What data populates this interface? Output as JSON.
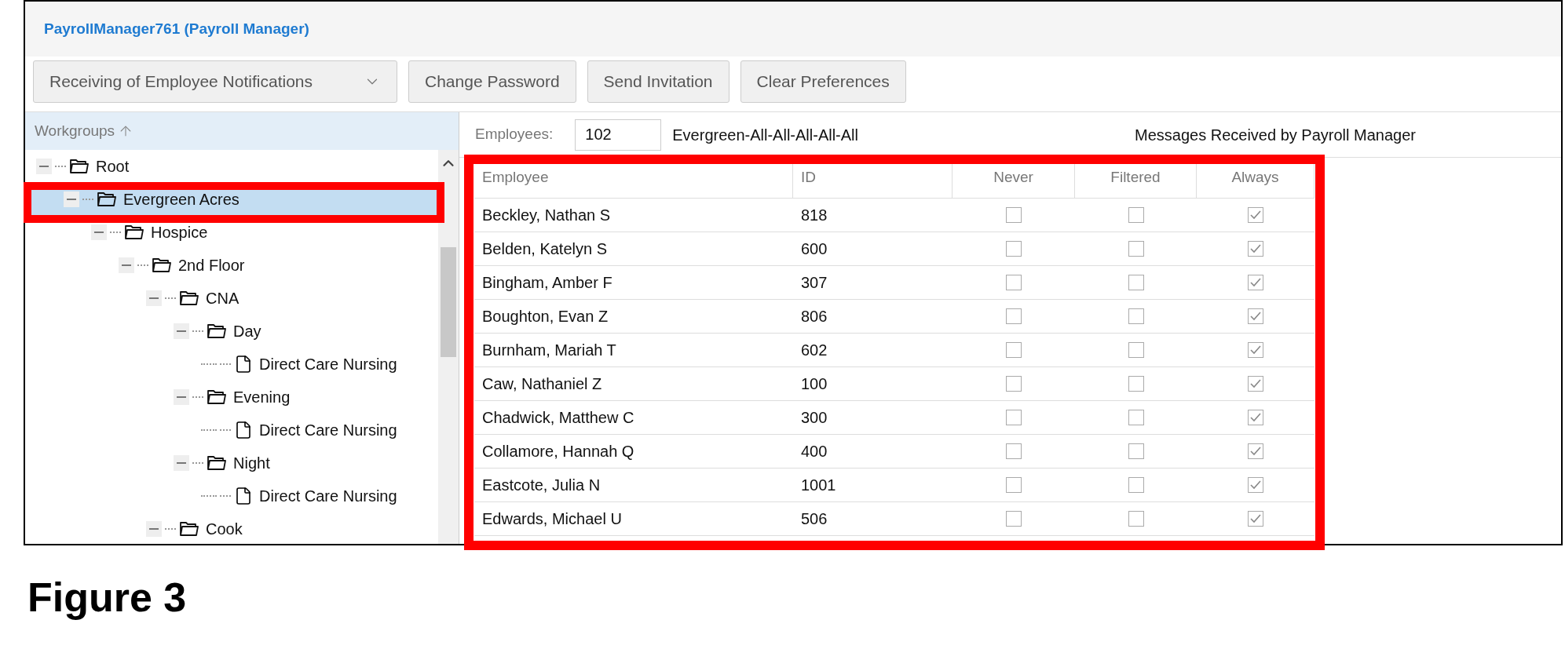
{
  "header": {
    "title": "PayrollManager761 (Payroll Manager)"
  },
  "toolbar": {
    "dropdown": "Receiving of Employee Notifications",
    "buttons": [
      "Change Password",
      "Send Invitation",
      "Clear Preferences"
    ]
  },
  "tree_header": "Workgroups",
  "tree": [
    {
      "label": "Root",
      "kind": "folder",
      "expanded": true,
      "selected": false,
      "children": [
        {
          "label": "Evergreen Acres",
          "kind": "folder",
          "expanded": true,
          "selected": true,
          "children": [
            {
              "label": "Hospice",
              "kind": "folder",
              "expanded": true,
              "selected": false,
              "children": [
                {
                  "label": "2nd Floor",
                  "kind": "folder",
                  "expanded": true,
                  "selected": false,
                  "children": [
                    {
                      "label": "CNA",
                      "kind": "folder",
                      "expanded": true,
                      "selected": false,
                      "children": [
                        {
                          "label": "Day",
                          "kind": "folder",
                          "expanded": true,
                          "selected": false,
                          "children": [
                            {
                              "label": "Direct Care Nursing",
                              "kind": "file",
                              "selected": false
                            }
                          ]
                        },
                        {
                          "label": "Evening",
                          "kind": "folder",
                          "expanded": true,
                          "selected": false,
                          "children": [
                            {
                              "label": "Direct Care Nursing",
                              "kind": "file",
                              "selected": false
                            }
                          ]
                        },
                        {
                          "label": "Night",
                          "kind": "folder",
                          "expanded": true,
                          "selected": false,
                          "children": [
                            {
                              "label": "Direct Care Nursing",
                              "kind": "file",
                              "selected": false
                            }
                          ]
                        }
                      ]
                    },
                    {
                      "label": "Cook",
                      "kind": "folder",
                      "expanded": true,
                      "selected": false
                    }
                  ]
                }
              ]
            }
          ]
        }
      ]
    }
  ],
  "employees_bar": {
    "label": "Employees:",
    "count": "102",
    "filter": "Evergreen-All-All-All-All-All",
    "note": "Messages Received by Payroll Manager"
  },
  "table": {
    "columns": [
      "Employee",
      "ID",
      "Never",
      "Filtered",
      "Always"
    ],
    "rows": [
      {
        "employee": "Beckley, Nathan S",
        "id": "818",
        "never": false,
        "filtered": false,
        "always": true
      },
      {
        "employee": "Belden, Katelyn S",
        "id": "600",
        "never": false,
        "filtered": false,
        "always": true
      },
      {
        "employee": "Bingham, Amber F",
        "id": "307",
        "never": false,
        "filtered": false,
        "always": true
      },
      {
        "employee": "Boughton, Evan Z",
        "id": "806",
        "never": false,
        "filtered": false,
        "always": true
      },
      {
        "employee": "Burnham, Mariah T",
        "id": "602",
        "never": false,
        "filtered": false,
        "always": true
      },
      {
        "employee": "Caw, Nathaniel Z",
        "id": "100",
        "never": false,
        "filtered": false,
        "always": true
      },
      {
        "employee": "Chadwick, Matthew C",
        "id": "300",
        "never": false,
        "filtered": false,
        "always": true
      },
      {
        "employee": "Collamore, Hannah Q",
        "id": "400",
        "never": false,
        "filtered": false,
        "always": true
      },
      {
        "employee": "Eastcote, Julia N",
        "id": "1001",
        "never": false,
        "filtered": false,
        "always": true
      },
      {
        "employee": "Edwards, Michael U",
        "id": "506",
        "never": false,
        "filtered": false,
        "always": true
      }
    ]
  },
  "caption": "Figure 3"
}
